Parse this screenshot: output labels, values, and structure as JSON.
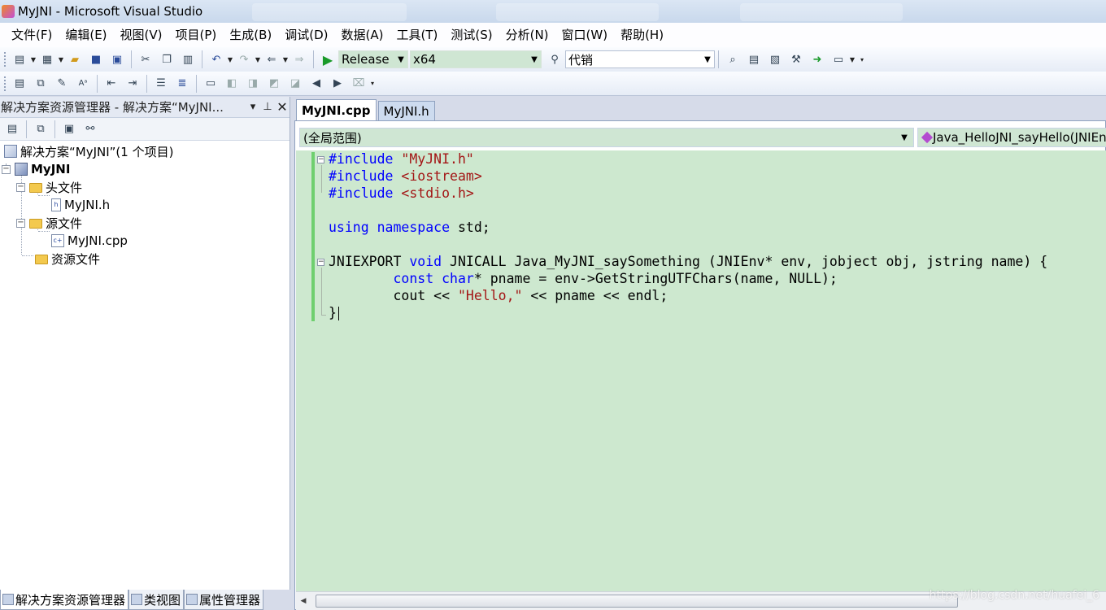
{
  "window": {
    "title": "MyJNI - Microsoft Visual Studio"
  },
  "menu": [
    "文件(F)",
    "编辑(E)",
    "视图(V)",
    "项目(P)",
    "生成(B)",
    "调试(D)",
    "数据(A)",
    "工具(T)",
    "测试(S)",
    "分析(N)",
    "窗口(W)",
    "帮助(H)"
  ],
  "toolbar": {
    "configuration": "Release",
    "platform": "x64",
    "find_text": "代销"
  },
  "solution_explorer": {
    "header": "解决方案资源管理器 - 解决方案“MyJNI...",
    "tree": {
      "solution": "解决方案“MyJNI”(1 个项目)",
      "project": "MyJNI",
      "headers_folder": "头文件",
      "header_file": "MyJNI.h",
      "sources_folder": "源文件",
      "source_file": "MyJNI.cpp",
      "resources_folder": "资源文件"
    },
    "bottom_tabs": [
      "解决方案资源管理器",
      "类视图",
      "属性管理器"
    ]
  },
  "editor": {
    "tabs": [
      "MyJNI.cpp",
      "MyJNI.h"
    ],
    "scope": "(全局范围)",
    "function": "Java_HelloJNI_sayHello(JNIEnv"
  },
  "code": {
    "l1_kw": "#include",
    "l1_str": "\"MyJNI.h\"",
    "l2_kw": "#include",
    "l2_str": "<iostream>",
    "l3_kw": "#include",
    "l3_str": "<stdio.h>",
    "l5_kw1": "using",
    "l5_kw2": "namespace",
    "l5_rest": "std;",
    "l7_a": "JNIEXPORT",
    "l7_kw": "void",
    "l7_rest": "JNICALL Java_MyJNI_saySomething (JNIEnv* env, jobject obj, jstring name) {",
    "l8_kw1": "const",
    "l8_kw2": "char",
    "l8_rest": "* pname = env->GetStringUTFChars(name, NULL);",
    "l9_a": "cout <<",
    "l9_str": "\"Hello,\"",
    "l9_rest": "<< pname << endl;",
    "l10": "}"
  },
  "watermark": "https://blog.csdn.net/huafei_6"
}
